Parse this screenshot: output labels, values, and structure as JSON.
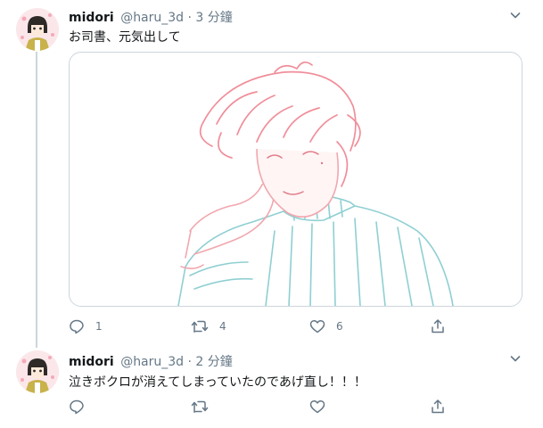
{
  "colors": {
    "accent": "#1da1f2",
    "muted": "#657786",
    "border": "#ccd6dd",
    "text": "#14171a"
  },
  "tweets": [
    {
      "display_name": "midori",
      "handle": "@haru_3d",
      "separator": "·",
      "time": "3 分鐘",
      "text": "お司書、元気出して",
      "media": {
        "description": "sketch illustration",
        "icon": "image"
      },
      "actions": {
        "reply_count": "1",
        "retweet_count": "4",
        "like_count": "6"
      }
    },
    {
      "display_name": "midori",
      "handle": "@haru_3d",
      "separator": "·",
      "time": "2 分鐘",
      "text": "泣きボクロが消えてしまっていたのであげ直し！！！",
      "actions": {
        "reply_count": "",
        "retweet_count": "",
        "like_count": ""
      }
    }
  ],
  "icons": [
    "avatar",
    "caret-down-icon",
    "reply-icon",
    "retweet-icon",
    "like-icon",
    "share-icon"
  ]
}
